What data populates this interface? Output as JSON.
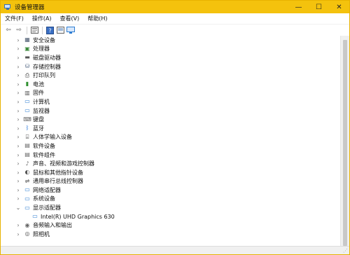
{
  "window": {
    "title": "设备管理器"
  },
  "titlebar": {
    "minimize": "—",
    "maximize": "☐",
    "close": "✕"
  },
  "menu": [
    "文件(F)",
    "操作(A)",
    "查看(V)",
    "帮助(H)"
  ],
  "toolbar": {
    "back": "⇦",
    "forward": "⇨",
    "help": "?"
  },
  "tree": [
    {
      "label": "安全设备",
      "icon": "security-device-icon",
      "expanded": false
    },
    {
      "label": "处理器",
      "icon": "processor-icon",
      "expanded": false
    },
    {
      "label": "磁盘驱动器",
      "icon": "disk-drive-icon",
      "expanded": false
    },
    {
      "label": "存储控制器",
      "icon": "storage-controller-icon",
      "expanded": false
    },
    {
      "label": "打印队列",
      "icon": "printer-icon",
      "expanded": false
    },
    {
      "label": "电池",
      "icon": "battery-icon",
      "expanded": false
    },
    {
      "label": "固件",
      "icon": "firmware-icon",
      "expanded": false
    },
    {
      "label": "计算机",
      "icon": "computer-icon",
      "expanded": false
    },
    {
      "label": "监视器",
      "icon": "monitor-icon",
      "expanded": false
    },
    {
      "label": "键盘",
      "icon": "keyboard-icon",
      "expanded": false
    },
    {
      "label": "蓝牙",
      "icon": "bluetooth-icon",
      "expanded": false
    },
    {
      "label": "人体学输入设备",
      "icon": "hid-icon",
      "expanded": false
    },
    {
      "label": "软件设备",
      "icon": "software-device-icon",
      "expanded": false
    },
    {
      "label": "软件组件",
      "icon": "software-component-icon",
      "expanded": false
    },
    {
      "label": "声音、视频和游戏控制器",
      "icon": "sound-icon",
      "expanded": false
    },
    {
      "label": "鼠标和其他指针设备",
      "icon": "mouse-icon",
      "expanded": false
    },
    {
      "label": "通用串行总线控制器",
      "icon": "usb-icon",
      "expanded": false
    },
    {
      "label": "网络适配器",
      "icon": "network-adapter-icon",
      "expanded": false
    },
    {
      "label": "系统设备",
      "icon": "system-device-icon",
      "expanded": false
    },
    {
      "label": "显示适配器",
      "icon": "display-adapter-icon",
      "expanded": true
    },
    {
      "label": "Intel(R) UHD Graphics 630",
      "icon": "display-adapter-icon",
      "child": true
    },
    {
      "label": "音频输入和输出",
      "icon": "audio-io-icon",
      "expanded": false
    },
    {
      "label": "照相机",
      "icon": "camera-icon",
      "expanded": false
    }
  ],
  "icon_glyphs": {
    "security-device-icon": "▦",
    "processor-icon": "▣",
    "disk-drive-icon": "▬",
    "storage-controller-icon": "⛁",
    "printer-icon": "⎙",
    "battery-icon": "▮",
    "firmware-icon": "▥",
    "computer-icon": "▭",
    "monitor-icon": "▭",
    "keyboard-icon": "⌨",
    "bluetooth-icon": "ᛒ",
    "hid-icon": "⌸",
    "software-device-icon": "▤",
    "software-component-icon": "▤",
    "sound-icon": "♪",
    "mouse-icon": "◐",
    "usb-icon": "⇌",
    "network-adapter-icon": "▭",
    "system-device-icon": "▭",
    "display-adapter-icon": "▭",
    "audio-io-icon": "◉",
    "camera-icon": "◎"
  },
  "icon_colors": {
    "security-device-icon": "#4a5a70",
    "processor-icon": "#3b8a3b",
    "disk-drive-icon": "#555555",
    "storage-controller-icon": "#5c6f8a",
    "printer-icon": "#444444",
    "battery-icon": "#2f8f2f",
    "firmware-icon": "#555555",
    "computer-icon": "#2d7dd2",
    "monitor-icon": "#2d7dd2",
    "keyboard-icon": "#666666",
    "bluetooth-icon": "#1e6fd9",
    "hid-icon": "#555555",
    "software-device-icon": "#666666",
    "software-component-icon": "#666666",
    "sound-icon": "#666666",
    "mouse-icon": "#555555",
    "usb-icon": "#444444",
    "network-adapter-icon": "#2d7dd2",
    "system-device-icon": "#2d7dd2",
    "display-adapter-icon": "#2d7dd2",
    "audio-io-icon": "#666666",
    "camera-icon": "#555555"
  },
  "colors": {
    "titlebar": "#f4c20d"
  }
}
